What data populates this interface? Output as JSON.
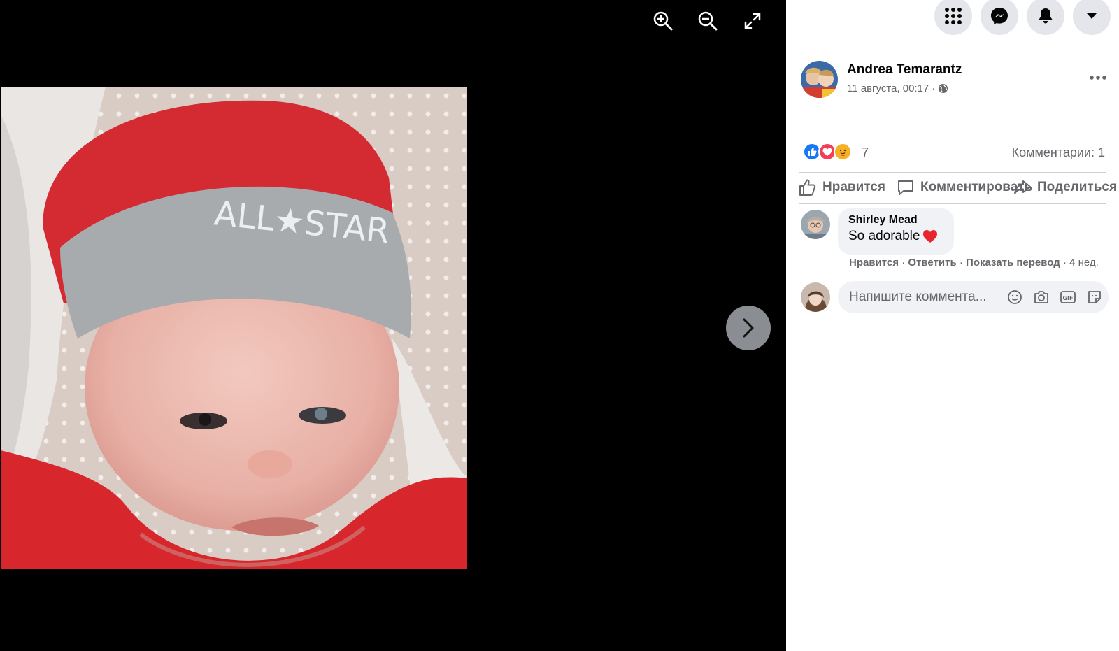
{
  "viewer": {
    "tools": [
      "zoom-in-icon",
      "zoom-out-icon",
      "fullscreen-icon"
    ],
    "next_icon": "chevron-right-icon",
    "photo_text": "ALL★STAR"
  },
  "topbar": {
    "buttons": [
      "menu-grid-icon",
      "messenger-icon",
      "bell-icon",
      "caret-down-icon"
    ]
  },
  "post": {
    "author": "Andrea Temarantz",
    "date": "11 августа, 00:17 ·",
    "privacy_icon": "globe-icon"
  },
  "reactions": {
    "icons": [
      "like",
      "love",
      "care"
    ],
    "count": "7",
    "comments_label": "Комментарии: 1"
  },
  "actions": {
    "like": "Нравится",
    "comment": "Комментировать",
    "share": "Поделиться"
  },
  "comment": {
    "name": "Shirley Mead",
    "text": "So adorable",
    "emoji": "❤️",
    "like": "Нравится",
    "reply": "Ответить",
    "translate": "Показать перевод",
    "time": "4 нед."
  },
  "composer": {
    "placeholder": "Напишите коммента..."
  },
  "colors": {
    "accent": "#1877f2",
    "love": "#f33e58",
    "care": "#f7b125"
  }
}
